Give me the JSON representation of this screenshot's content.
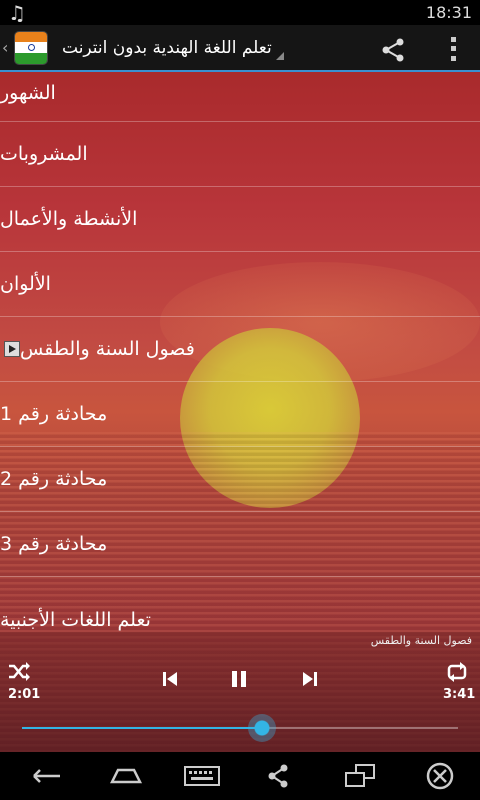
{
  "status_bar": {
    "notification_icon": "music-note-icon",
    "clock": "18:31"
  },
  "action_bar": {
    "title": "تعلم اللغة الهندية بدون انترنت",
    "app_icon": "india-flag-app-icon"
  },
  "list": {
    "items": [
      {
        "label": "الشهور"
      },
      {
        "label": "المشروبات"
      },
      {
        "label": "الأنشطة والأعمال"
      },
      {
        "label": "الألوان"
      },
      {
        "label": "فصول السنة والطقس",
        "playing": true
      },
      {
        "label": "محادثة  رقم 1"
      },
      {
        "label": "محادثة  رقم 2"
      },
      {
        "label": "محادثة رقم 3"
      },
      {
        "label": "تعلم اللغات الأجنبية"
      }
    ]
  },
  "player": {
    "now_playing": "فصول السنة والطقس",
    "elapsed": "2:01",
    "duration": "3:41",
    "progress_fraction": 0.55
  },
  "colors": {
    "accent": "#33b5e5",
    "action_bar": "#151515"
  }
}
